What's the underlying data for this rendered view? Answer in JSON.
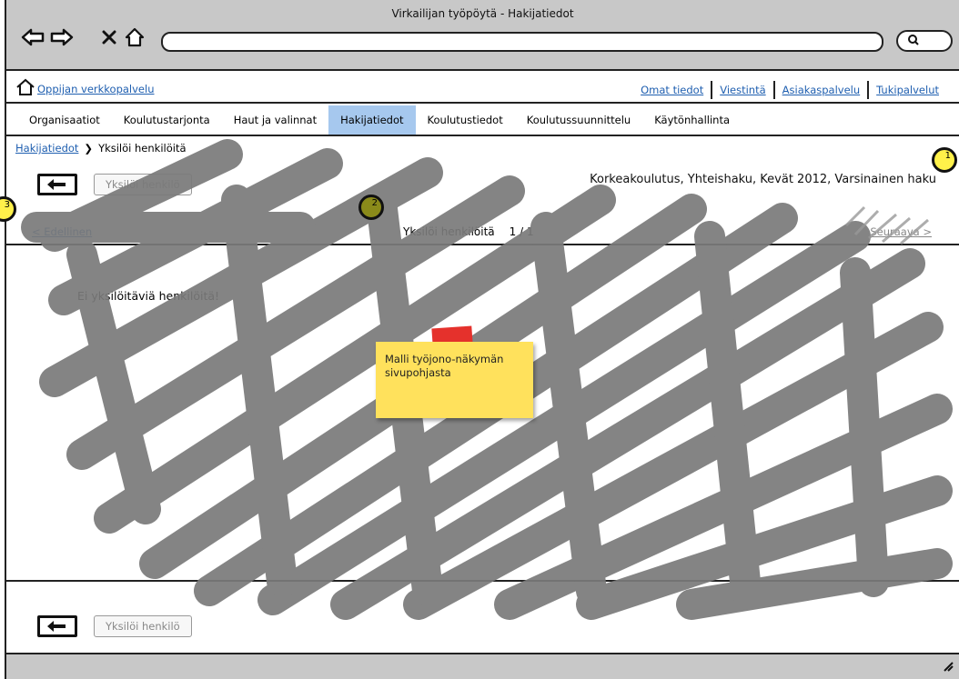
{
  "window": {
    "title": "Virkailijan työpöytä - Hakijatiedot"
  },
  "browser": {
    "back_icon": "arrow-left-icon",
    "forward_icon": "arrow-right-icon",
    "stop_icon": "close-icon",
    "home_icon": "home-icon",
    "url": "",
    "search_icon": "search-icon"
  },
  "header": {
    "portal_link": "Oppijan verkkopalvelu",
    "links": [
      "Omat tiedot",
      "Viestintä",
      "Asiakaspalvelu",
      "Tukipalvelut"
    ]
  },
  "tabs": [
    {
      "label": "Organisaatiot",
      "active": false
    },
    {
      "label": "Koulutustarjonta",
      "active": false
    },
    {
      "label": "Haut ja valinnat",
      "active": false
    },
    {
      "label": "Hakijatiedot",
      "active": true
    },
    {
      "label": "Koulutustiedot",
      "active": false
    },
    {
      "label": "Koulutussuunnittelu",
      "active": false
    },
    {
      "label": "Käytönhallinta",
      "active": false
    }
  ],
  "breadcrumb": {
    "root": "Hakijatiedot",
    "separator": ">",
    "current": "Yksilöi henkilöitä"
  },
  "toolbar": {
    "action_label": "Yksilöi henkilö"
  },
  "context_title": "Korkeakoulutus, Yhteishaku, Kevät 2012, Varsinainen haku",
  "pager": {
    "prev": "< Edellinen",
    "next": "Seuraava >",
    "title": "Yksilöi henkilöitä",
    "count": "1 / 1"
  },
  "content": {
    "empty_message": "Ei yksilöitäviä henkilöitä!"
  },
  "sticky_note": {
    "text": "Malli työjono-näkymän sivupohjasta"
  },
  "markers": [
    "1",
    "2",
    "3"
  ],
  "colors": {
    "active_tab": "#a6c8ee",
    "link": "#1f5fb0",
    "sticky": "#ffe15c",
    "marker": "#fff14a",
    "chrome": "#c8c8c8"
  }
}
